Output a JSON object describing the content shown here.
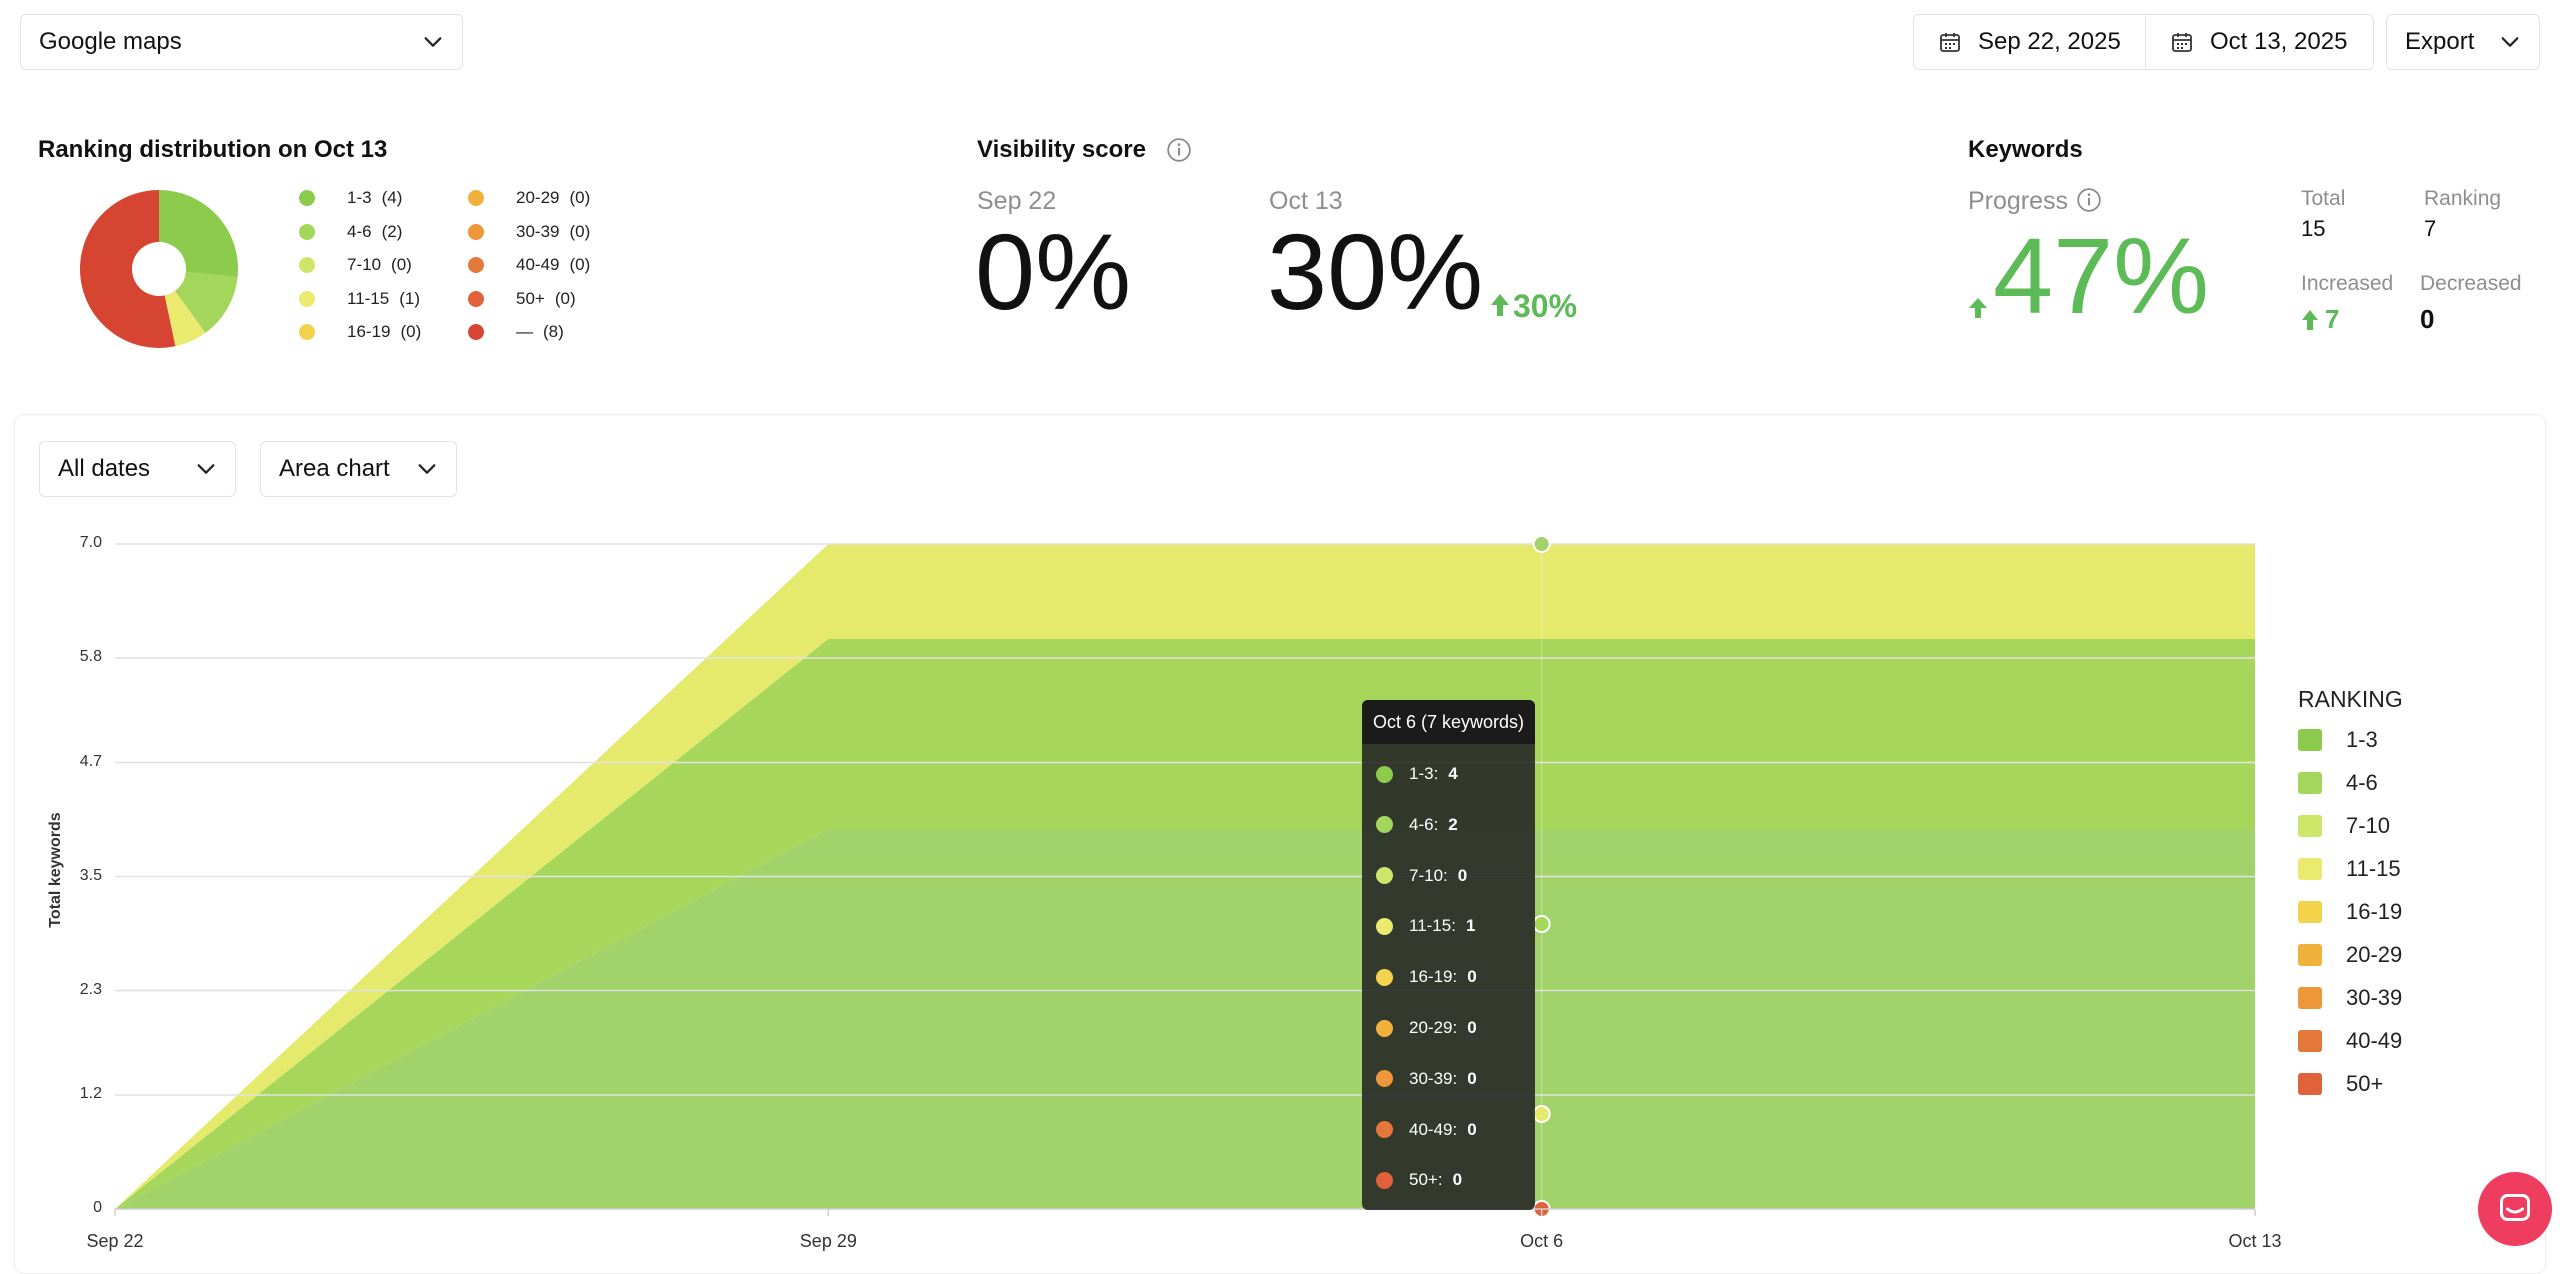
{
  "header": {
    "source_select": "Google maps",
    "date_start": "Sep 22, 2025",
    "date_end": "Oct 13, 2025",
    "export_label": "Export"
  },
  "distribution": {
    "title": "Ranking distribution on Oct 13",
    "items": [
      {
        "label": "1-3",
        "count": "(4)",
        "color": "#8ccb4b"
      },
      {
        "label": "4-6",
        "count": "(2)",
        "color": "#a5d65c"
      },
      {
        "label": "7-10",
        "count": "(0)",
        "color": "#cde66a"
      },
      {
        "label": "11-15",
        "count": "(1)",
        "color": "#eaea6e"
      },
      {
        "label": "16-19",
        "count": "(0)",
        "color": "#f3d34d"
      },
      {
        "label": "20-29",
        "count": "(0)",
        "color": "#f1b23d"
      },
      {
        "label": "30-39",
        "count": "(0)",
        "color": "#ee963a"
      },
      {
        "label": "40-49",
        "count": "(0)",
        "color": "#e4783a"
      },
      {
        "label": "50+",
        "count": "(0)",
        "color": "#e0613a"
      },
      {
        "label": "—",
        "count": "(8)",
        "color": "#d64532"
      }
    ],
    "pie_values": [
      4,
      2,
      0,
      1,
      0,
      0,
      0,
      0,
      0,
      8
    ]
  },
  "visibility": {
    "title": "Visibility score",
    "from_label": "Sep 22",
    "from_value": "0%",
    "to_label": "Oct 13",
    "to_value": "30%",
    "change": "30%",
    "info_icon": "info-icon"
  },
  "keywords": {
    "title": "Keywords",
    "progress_label": "Progress",
    "progress_value": "47%",
    "total_label": "Total",
    "total_value": "15",
    "ranking_label": "Ranking",
    "ranking_value": "7",
    "increased_label": "Increased",
    "increased_value": "7",
    "decreased_label": "Decreased",
    "decreased_value": "0"
  },
  "chart_controls": {
    "dates_select": "All dates",
    "type_select": "Area chart"
  },
  "chart_data": {
    "type": "area",
    "ylabel": "Total keywords",
    "x": [
      "Sep 22",
      "Sep 29",
      "Oct 6",
      "Oct 13"
    ],
    "y_ticks": [
      "0",
      "1.2",
      "2.3",
      "3.5",
      "4.7",
      "5.8",
      "7.0"
    ],
    "ylim": [
      0,
      7.0
    ],
    "stacked": true,
    "legend_title": "RANKING",
    "legend_placement": "right",
    "series": [
      {
        "name": "1-3",
        "color": "#a2d36b",
        "values": [
          0,
          4,
          4,
          4
        ]
      },
      {
        "name": "4-6",
        "color": "#a6d75b",
        "values": [
          0,
          2,
          2,
          2
        ]
      },
      {
        "name": "7-10",
        "color": "#cde66a",
        "values": [
          0,
          0,
          0,
          0
        ]
      },
      {
        "name": "11-15",
        "color": "#e6ea6c",
        "values": [
          0,
          1,
          1,
          1
        ]
      },
      {
        "name": "16-19",
        "color": "#f3d34d",
        "values": [
          0,
          0,
          0,
          0
        ]
      },
      {
        "name": "20-29",
        "color": "#f1b23d",
        "values": [
          0,
          0,
          0,
          0
        ]
      },
      {
        "name": "30-39",
        "color": "#ee963a",
        "values": [
          0,
          0,
          0,
          0
        ]
      },
      {
        "name": "40-49",
        "color": "#e4783a",
        "values": [
          0,
          0,
          0,
          0
        ]
      },
      {
        "name": "50+",
        "color": "#e0613a",
        "values": [
          0,
          0,
          0,
          0
        ]
      }
    ],
    "tooltip": {
      "title": "Oct 6 (7 keywords)",
      "rows": [
        {
          "label": "1-3:",
          "value": "4"
        },
        {
          "label": "4-6:",
          "value": "2"
        },
        {
          "label": "7-10:",
          "value": "0"
        },
        {
          "label": "11-15:",
          "value": "1"
        },
        {
          "label": "16-19:",
          "value": "0"
        },
        {
          "label": "20-29:",
          "value": "0"
        },
        {
          "label": "30-39:",
          "value": "0"
        },
        {
          "label": "40-49:",
          "value": "0"
        },
        {
          "label": "50+:",
          "value": "0"
        }
      ]
    }
  },
  "chat_button_icon": "chat-icon"
}
